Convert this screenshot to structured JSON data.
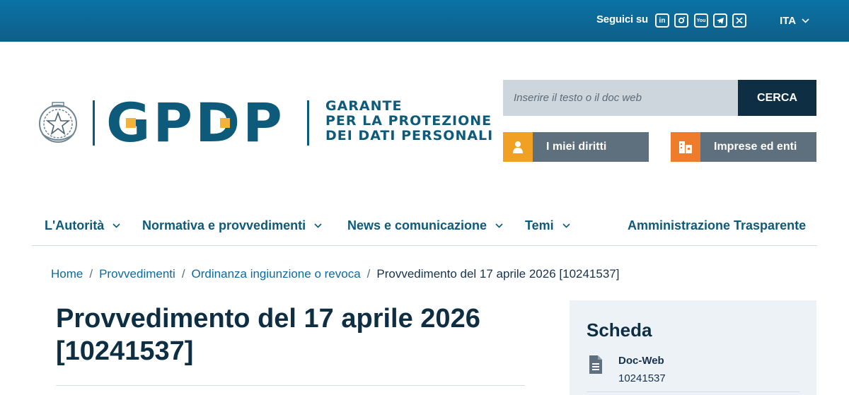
{
  "topbar": {
    "follow_label": "Seguici su",
    "socials": [
      {
        "icon": "linkedin-icon",
        "glyph": "in"
      },
      {
        "icon": "instagram-icon",
        "glyph": ""
      },
      {
        "icon": "youtube-icon",
        "glyph": "You"
      },
      {
        "icon": "telegram-icon",
        "glyph": ""
      },
      {
        "icon": "x-icon",
        "glyph": ""
      }
    ],
    "language": "ITA"
  },
  "header": {
    "logo_letters": "GPDP",
    "garante_lines": [
      "GARANTE",
      "PER LA PROTEZIONE",
      "DEI DATI PERSONALI"
    ],
    "search_placeholder": "Inserire il testo o il doc web",
    "search_button": "CERCA",
    "quick_links": [
      {
        "label": "I miei diritti",
        "icon": "person-icon",
        "color": "#f0a023"
      },
      {
        "label": "Imprese ed enti",
        "icon": "building-icon",
        "color": "#ef7b2d"
      }
    ]
  },
  "nav": {
    "items": [
      {
        "label": "L'Autorità"
      },
      {
        "label": "Normativa e provvedimenti"
      },
      {
        "label": "News e comunicazione"
      },
      {
        "label": "Temi"
      }
    ],
    "right_item": "Amministrazione Trasparente"
  },
  "breadcrumb": {
    "items": [
      "Home",
      "Provvedimenti",
      "Ordinanza ingiunzione o revoca"
    ],
    "current": "Provvedimento del 17 aprile 2026 [10241537]"
  },
  "page": {
    "title_line1": "Provvedimento del 17 aprile 2026",
    "title_line2": "[10241537]"
  },
  "scheda": {
    "title": "Scheda",
    "doc_label": "Doc-Web",
    "doc_value": "10241537"
  },
  "colors": {
    "topbar": "#0b72a6",
    "brand": "#0d5a7a",
    "accent": "#f0b43c",
    "dark": "#0e2e44"
  }
}
